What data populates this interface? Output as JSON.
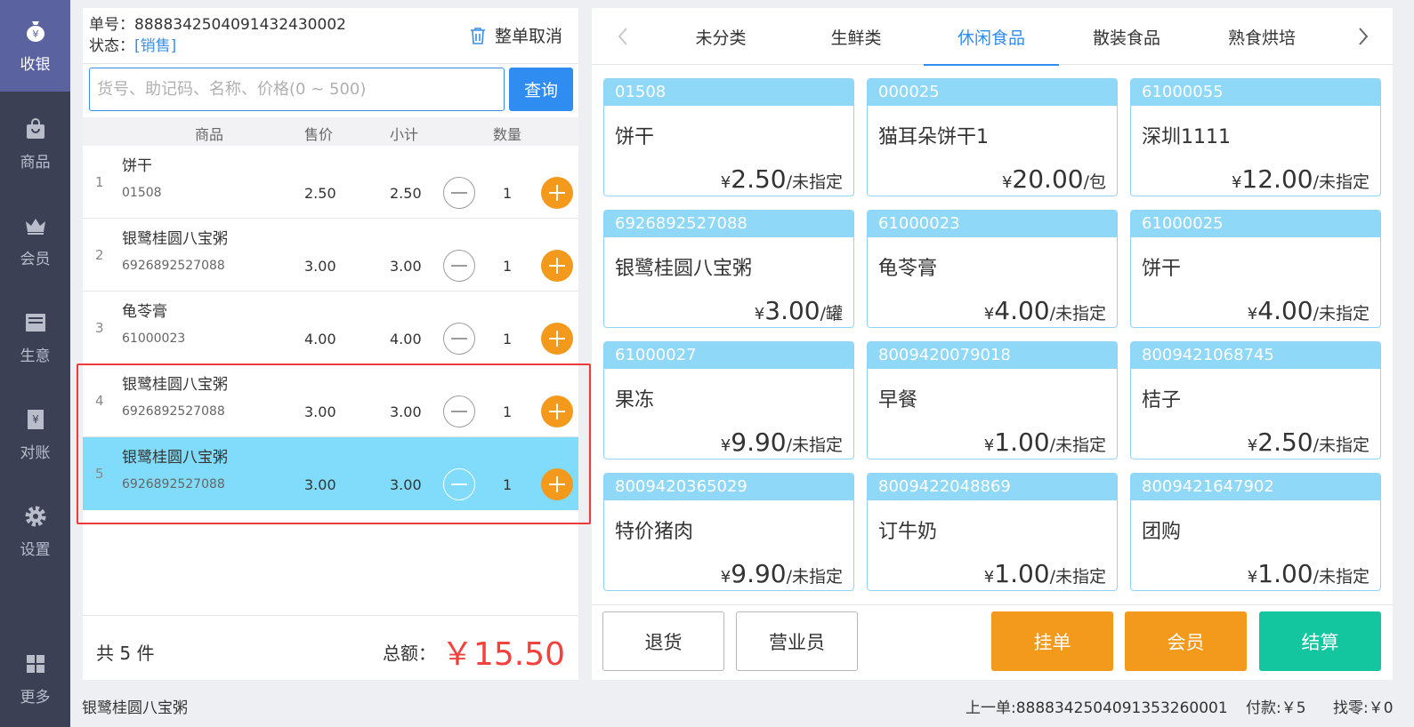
{
  "sidebar": {
    "items": [
      {
        "label": "收银",
        "icon": "cash-bag-icon",
        "active": true
      },
      {
        "label": "商品",
        "icon": "shopping-bag-icon"
      },
      {
        "label": "会员",
        "icon": "crown-icon"
      },
      {
        "label": "生意",
        "icon": "register-icon"
      },
      {
        "label": "对账",
        "icon": "receipt-icon"
      },
      {
        "label": "设置",
        "icon": "gear-icon"
      },
      {
        "label": "更多",
        "icon": "grid-icon"
      }
    ]
  },
  "order": {
    "number_label": "单号：",
    "number": "8888342504091432430002",
    "status_label": "状态：",
    "status": "[销售]",
    "cancel_label": "整单取消"
  },
  "search": {
    "placeholder": "货号、助记码、名称、价格(0 ~ 500)",
    "button": "查询"
  },
  "cart_headers": {
    "product": "商品",
    "price": "售价",
    "subtotal": "小计",
    "qty": "数量"
  },
  "cart": [
    {
      "index": "1",
      "name": "饼干",
      "code": "01508",
      "price": "2.50",
      "subtotal": "2.50",
      "qty": "1"
    },
    {
      "index": "2",
      "name": "银鹭桂圆八宝粥",
      "code": "6926892527088",
      "price": "3.00",
      "subtotal": "3.00",
      "qty": "1"
    },
    {
      "index": "3",
      "name": "龟苓膏",
      "code": "61000023",
      "price": "4.00",
      "subtotal": "4.00",
      "qty": "1"
    },
    {
      "index": "4",
      "name": "银鹭桂圆八宝粥",
      "code": "6926892527088",
      "price": "3.00",
      "subtotal": "3.00",
      "qty": "1"
    },
    {
      "index": "5",
      "name": "银鹭桂圆八宝粥",
      "code": "6926892527088",
      "price": "3.00",
      "subtotal": "3.00",
      "qty": "1",
      "selected": true
    }
  ],
  "summary": {
    "count": "共 5 件",
    "total_label": "总额：",
    "total": "￥15.50"
  },
  "categories": [
    "未分类",
    "生鲜类",
    "休闲食品",
    "散装食品",
    "熟食烘培"
  ],
  "active_category": "休闲食品",
  "products": [
    {
      "code": "01508",
      "name": "饼干",
      "currency": "¥",
      "price": "2.50",
      "unit": "/未指定"
    },
    {
      "code": "000025",
      "name": "猫耳朵饼干1",
      "currency": "¥",
      "price": "20.00",
      "unit": "/包"
    },
    {
      "code": "61000055",
      "name": "深圳1111",
      "currency": "¥",
      "price": "12.00",
      "unit": "/未指定"
    },
    {
      "code": "6926892527088",
      "name": "银鹭桂圆八宝粥",
      "currency": "¥",
      "price": "3.00",
      "unit": "/罐"
    },
    {
      "code": "61000023",
      "name": "龟苓膏",
      "currency": "¥",
      "price": "4.00",
      "unit": "/未指定"
    },
    {
      "code": "61000025",
      "name": "饼干",
      "currency": "¥",
      "price": "4.00",
      "unit": "/未指定"
    },
    {
      "code": "61000027",
      "name": "果冻",
      "currency": "¥",
      "price": "9.90",
      "unit": "/未指定"
    },
    {
      "code": "8009420079018",
      "name": "早餐",
      "currency": "¥",
      "price": "1.00",
      "unit": "/未指定"
    },
    {
      "code": "8009421068745",
      "name": "桔子",
      "currency": "¥",
      "price": "2.50",
      "unit": "/未指定"
    },
    {
      "code": "8009420365029",
      "name": "特价猪肉",
      "currency": "¥",
      "price": "9.90",
      "unit": "/未指定"
    },
    {
      "code": "8009422048869",
      "name": "订牛奶",
      "currency": "¥",
      "price": "1.00",
      "unit": "/未指定"
    },
    {
      "code": "8009421647902",
      "name": "团购",
      "currency": "¥",
      "price": "1.00",
      "unit": "/未指定"
    }
  ],
  "actions": {
    "return": "退货",
    "salesperson": "营业员",
    "hold": "挂单",
    "member": "会员",
    "checkout": "结算"
  },
  "colors": {
    "hold": "#f39a1c",
    "member": "#f39a1c",
    "checkout": "#14c6a0"
  },
  "status_bar": {
    "current_item": "银鹭桂圆八宝粥",
    "last_order": "上一单:8888342504091353260001",
    "paid": "付款:￥5",
    "change": "找零:￥0"
  }
}
